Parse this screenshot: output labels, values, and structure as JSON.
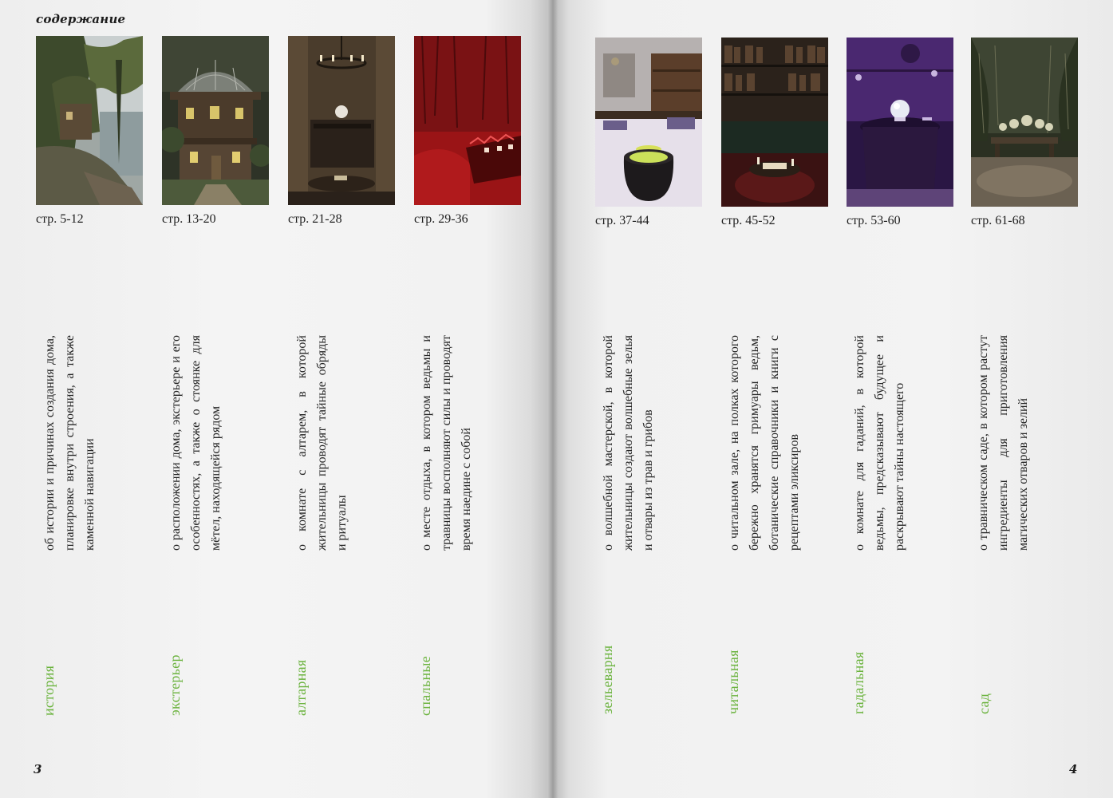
{
  "spread": {
    "heading": "содержание",
    "left_folio": "3",
    "right_folio": "4"
  },
  "sections": [
    {
      "pages": "стр. 5-12",
      "title": "история",
      "description": "об истории и причинах создания дома, планировке внутри строения, а также каменной навигации",
      "thumbnail": "lakeside-forest-house-photo"
    },
    {
      "pages": "стр. 13-20",
      "title": "экстерьер",
      "description": "о расположении дома, экстерьере и его особенностях, а также о стоянке для мётел, находящейся рядом",
      "thumbnail": "domed-tower-house-photo"
    },
    {
      "pages": "стр. 21-28",
      "title": "алтарная",
      "description": "о комнате с алтарем, в которой жительницы проводят тайные обряды и ритуалы",
      "thumbnail": "altar-room-chandelier-photo"
    },
    {
      "pages": "стр. 29-36",
      "title": "спальные",
      "description": "о месте отдыха, в котором ведьмы и травницы восполняют силы и проводят время наедине с собой",
      "thumbnail": "red-bedroom-photo"
    },
    {
      "pages": "стр. 37-44",
      "title": "зельеварня",
      "description": "о волшебной мастерской, в которой жительницы создают волшебные зелья и отвары из трав и грибов",
      "thumbnail": "potion-cauldron-workshop-photo"
    },
    {
      "pages": "стр. 45-52",
      "title": "читальная",
      "description": "о читальном зале, на полках которого бережно хранятся гримуары ведьм, ботанические справочники и книги с рецептами эликсиров",
      "thumbnail": "library-reading-room-photo"
    },
    {
      "pages": "стр. 53-60",
      "title": "гадальная",
      "description": "о комнате для гаданий, в которой ведьмы, предсказывают будущее и раскрывают тайны настоящего",
      "thumbnail": "purple-divination-room-photo"
    },
    {
      "pages": "стр. 61-68",
      "title": "сад",
      "description": "о травническом саде, в котором растут ингредиенты для приготовления магических отваров и зелий",
      "thumbnail": "herbal-garden-photo"
    }
  ],
  "colors": {
    "accent_green": "#6bb33e",
    "body_text": "#262626"
  }
}
